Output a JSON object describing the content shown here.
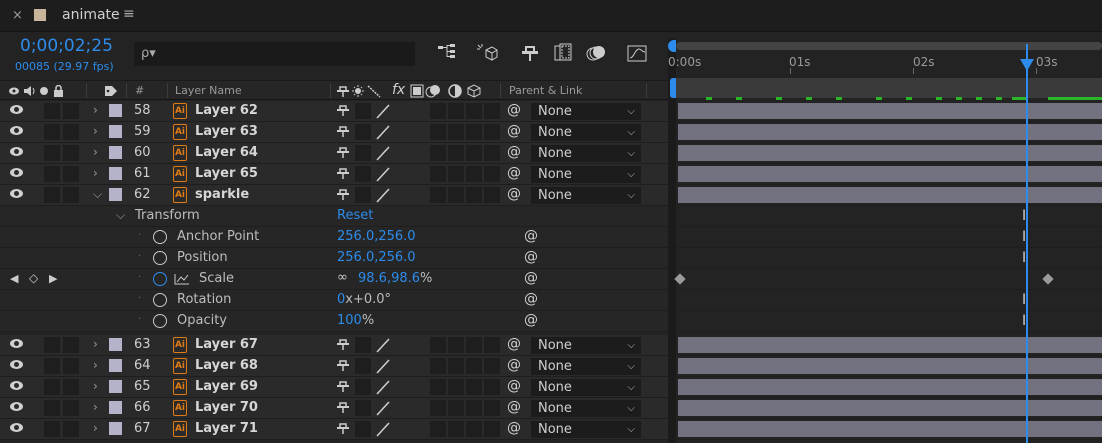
{
  "tab": {
    "close": "×",
    "title": "animate",
    "menu": "≡"
  },
  "header": {
    "timecode": "0;00;02;25",
    "frame_info": "00085 (29.97 fps)",
    "search_placeholder": "",
    "search_icon": "ρ▾"
  },
  "columns": {
    "number": "#",
    "layer_name": "Layer Name",
    "parent_link": "Parent & Link",
    "switch_fx": "fx"
  },
  "ruler": {
    "labels": [
      "0:00s",
      "01s",
      "02s",
      "03s"
    ]
  },
  "layers_top": [
    {
      "num": "58",
      "name": "Layer 62",
      "parent": "None"
    },
    {
      "num": "59",
      "name": "Layer 63",
      "parent": "None"
    },
    {
      "num": "60",
      "name": "Layer 64",
      "parent": "None"
    },
    {
      "num": "61",
      "name": "Layer 65",
      "parent": "None"
    },
    {
      "num": "62",
      "name": "sparkle",
      "parent": "None"
    }
  ],
  "transform": {
    "label": "Transform",
    "reset": "Reset",
    "props": [
      {
        "name": "Anchor Point",
        "value": "256.0,256.0",
        "suffix": ""
      },
      {
        "name": "Position",
        "value": "256.0,256.0",
        "suffix": ""
      },
      {
        "name": "Scale",
        "link": "∞",
        "value": "98.6,98.6",
        "suffix": "%"
      },
      {
        "name": "Rotation",
        "value": "0",
        "suffix": "x+0.0°"
      },
      {
        "name": "Opacity",
        "value": "100",
        "suffix": "%"
      }
    ]
  },
  "layers_bottom": [
    {
      "num": "63",
      "name": "Layer 67",
      "parent": "None"
    },
    {
      "num": "64",
      "name": "Layer 68",
      "parent": "None"
    },
    {
      "num": "65",
      "name": "Layer 69",
      "parent": "None"
    },
    {
      "num": "66",
      "name": "Layer 70",
      "parent": "None"
    },
    {
      "num": "67",
      "name": "Layer 71",
      "parent": "None"
    }
  ],
  "colors": {
    "accent": "#2d8ceb",
    "layer_bar": "#72717f",
    "label": "#b4b3c9",
    "file_icon": "#e07a12"
  }
}
